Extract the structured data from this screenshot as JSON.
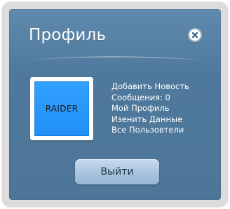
{
  "panel": {
    "title": "Профиль",
    "close_icon": "close-icon"
  },
  "avatar": {
    "label": "RAIDER"
  },
  "menu": {
    "items": [
      {
        "label": "Добавить Новость"
      },
      {
        "label": "Сообщения: 0"
      },
      {
        "label": "Мой Профиль"
      },
      {
        "label": "Изенить Данные"
      },
      {
        "label": "Все Пользовтели"
      }
    ]
  },
  "actions": {
    "logout_label": "Выйти"
  },
  "colors": {
    "panel_bg": "#5683a6",
    "outer_frame": "#dcdcdc",
    "avatar_bg": "#2196f8",
    "button_bg": "#a9c5de"
  }
}
